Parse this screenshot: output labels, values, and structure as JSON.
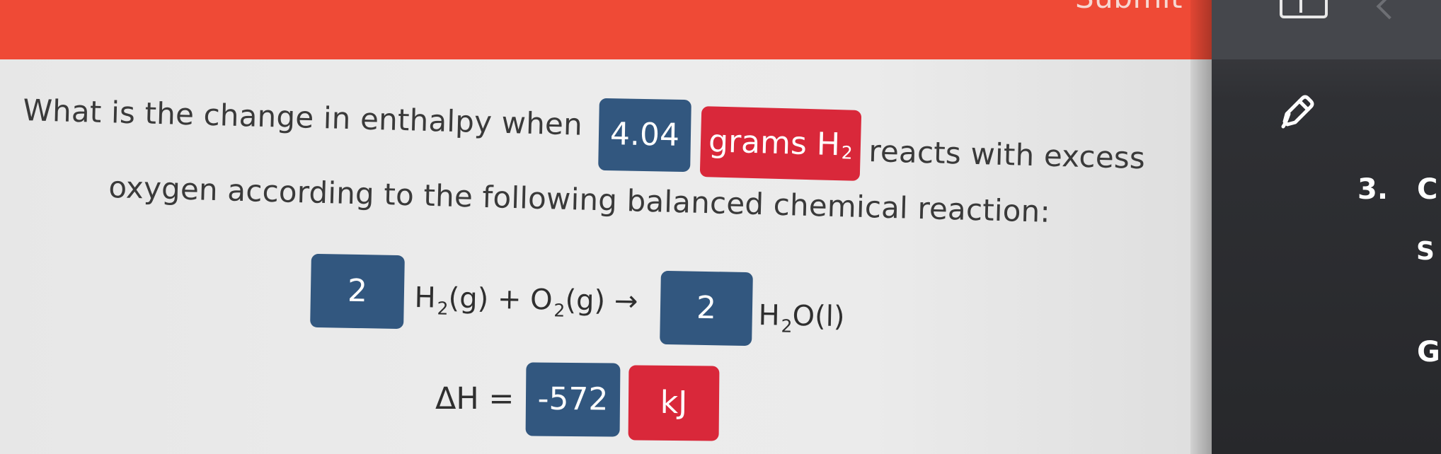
{
  "header": {
    "submit_label": "Submit"
  },
  "question": {
    "line_1_before": "What is the change in enthalpy when",
    "mass_value": "4.04",
    "unit_label": "grams H",
    "unit_subscript": "2",
    "line_1_after": "reacts with excess",
    "line_2": "oxygen according to the following balanced chemical reaction:"
  },
  "equation": {
    "reactant_coefficient": "2",
    "reactant_h2": "H",
    "reactant_h2_subscript": "2",
    "reactant_h2_state": "(g) + O",
    "reactant_o2_subscript": "2",
    "reactant_o2_state": "(g) →",
    "product_coefficient": "2",
    "product_h": "H",
    "product_h_subscript": "2",
    "product_rest": "O(l)"
  },
  "enthalpy": {
    "label": "ΔH =",
    "value": "-572",
    "unit": "kJ"
  },
  "side": {
    "question_number": "3.",
    "question_letter": "C",
    "letter_s": "S",
    "letter_g": "G"
  },
  "icons": {
    "layout": "layout-icon",
    "edit": "edit-icon",
    "chevron": "chevron-icon"
  },
  "colors": {
    "submit_bar": "#ef4a36",
    "blue_tile": "#32577f",
    "red_tile": "#d9283a",
    "dark_panel": "#2f3034",
    "text": "#3a3a3a"
  }
}
